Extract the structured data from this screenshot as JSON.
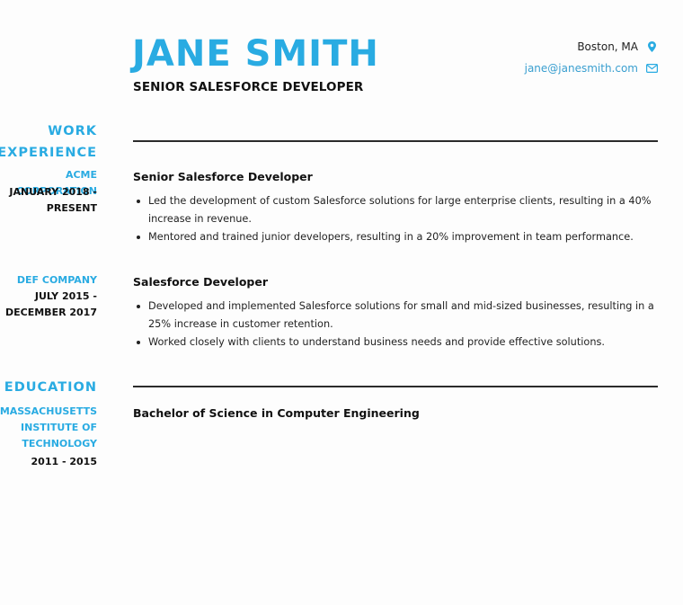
{
  "header": {
    "name": "JANE SMITH",
    "title": "SENIOR SALESFORCE DEVELOPER"
  },
  "contact": {
    "location": "Boston, MA",
    "location_icon": "map-pin-icon",
    "email": "jane@janesmith.com",
    "email_icon": "envelope-icon"
  },
  "colors": {
    "accent": "#29abe2",
    "text": "#111111",
    "rule": "#2b2b2b"
  },
  "work_experience": {
    "heading_line1": "WORK",
    "heading_line2": "EXPERIENCE",
    "jobs": [
      {
        "company": "ACME CORPORATION",
        "date_line1": "JANUARY 2018 -",
        "date_line2": "PRESENT",
        "title": "Senior Salesforce Developer",
        "bullets": [
          "Led the development of custom Salesforce solutions for large enterprise clients, resulting in a 40% increase in revenue.",
          "Mentored and trained junior developers, resulting in a 20% improvement in team performance."
        ]
      },
      {
        "company": "DEF COMPANY",
        "date_line1": "JULY 2015 -",
        "date_line2": "DECEMBER 2017",
        "title": "Salesforce Developer",
        "bullets": [
          "Developed and implemented Salesforce solutions for small and mid-sized businesses, resulting in a 25% increase in customer retention.",
          "Worked closely with clients to understand business needs and provide effective solutions."
        ]
      }
    ]
  },
  "education": {
    "heading": "EDUCATION",
    "school_line1": "MASSACHUSETTS",
    "school_line2": "INSTITUTE OF",
    "school_line3": "TECHNOLOGY",
    "dates": "2011 - 2015",
    "degree": "Bachelor of Science in Computer Engineering"
  }
}
